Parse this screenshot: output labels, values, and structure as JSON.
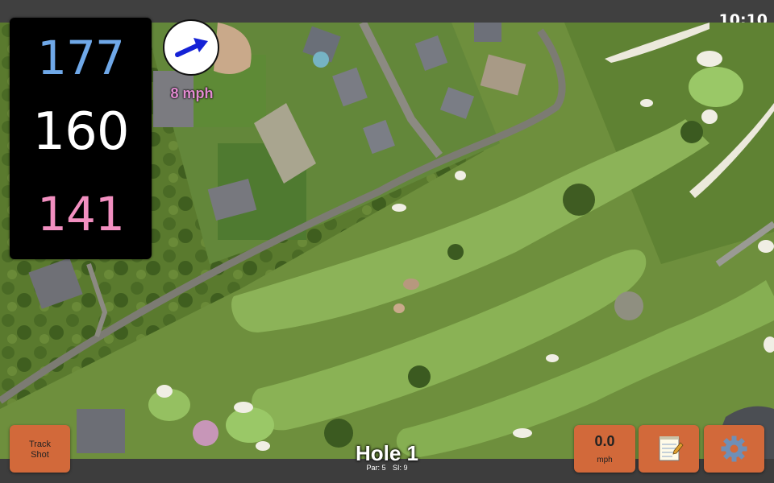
{
  "status_bar": {
    "time": "10:10"
  },
  "yardages": {
    "back": "177",
    "center": "160",
    "front": "141"
  },
  "wind": {
    "speed_text": "8 mph",
    "direction": "arrow pointing up-right"
  },
  "hole": {
    "title": "Hole 1",
    "par_text": "Par: 5",
    "si_text": "SI: 9"
  },
  "buttons": {
    "track_shot": {
      "line1": "Track",
      "line2": "Shot"
    },
    "speed": {
      "value": "0.0",
      "unit": "mph"
    },
    "notes_icon": "notepad-icon",
    "settings_icon": "gear-icon"
  },
  "colors": {
    "back_yardage": "#6fa8e8",
    "center_yardage": "#ffffff",
    "front_yardage": "#f28fc0",
    "wind_text": "#e38bd1",
    "button": "#d2693a",
    "wind_arrow": "#1522d6"
  }
}
